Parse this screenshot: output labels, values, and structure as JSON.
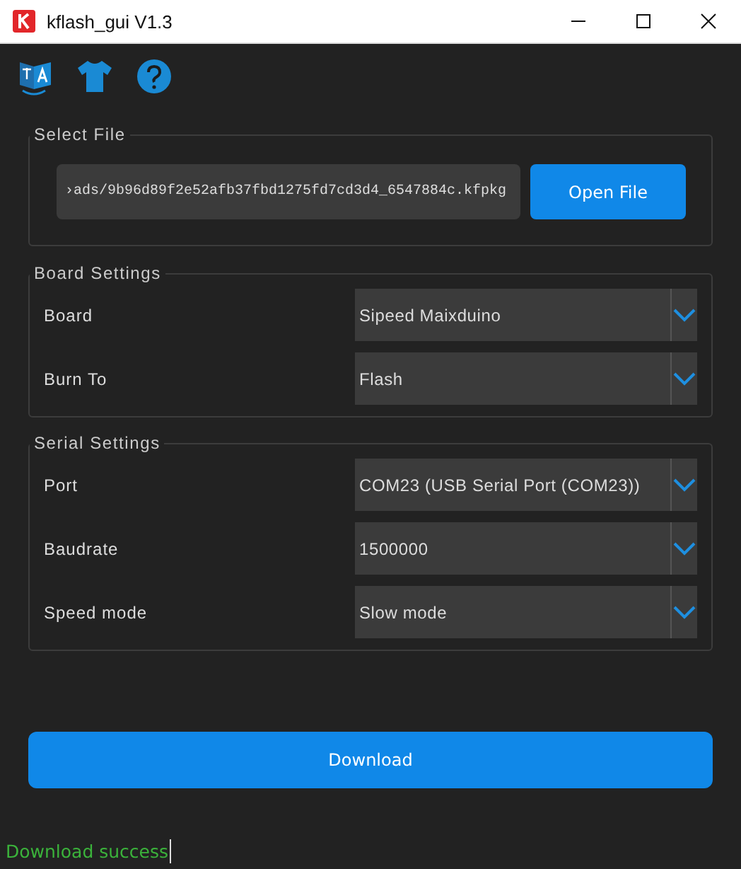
{
  "window": {
    "title": "kflash_gui V1.3"
  },
  "select_file": {
    "title": "Select File",
    "path": "›ads/9b96d89f2e52afb37fbd1275fd7cd3d4_6547884c.kfpkg",
    "button": "Open File"
  },
  "groups": [
    {
      "title": "Board Settings",
      "rows": [
        {
          "label": "Board",
          "value": "Sipeed Maixduino"
        },
        {
          "label": "Burn To",
          "value": "Flash"
        }
      ]
    },
    {
      "title": "Serial Settings",
      "rows": [
        {
          "label": "Port",
          "value": "COM23 (USB Serial Port (COM23))"
        },
        {
          "label": "Baudrate",
          "value": "1500000"
        },
        {
          "label": "Speed mode",
          "value": "Slow mode"
        }
      ]
    }
  ],
  "download_button": "Download",
  "status": "Download success"
}
